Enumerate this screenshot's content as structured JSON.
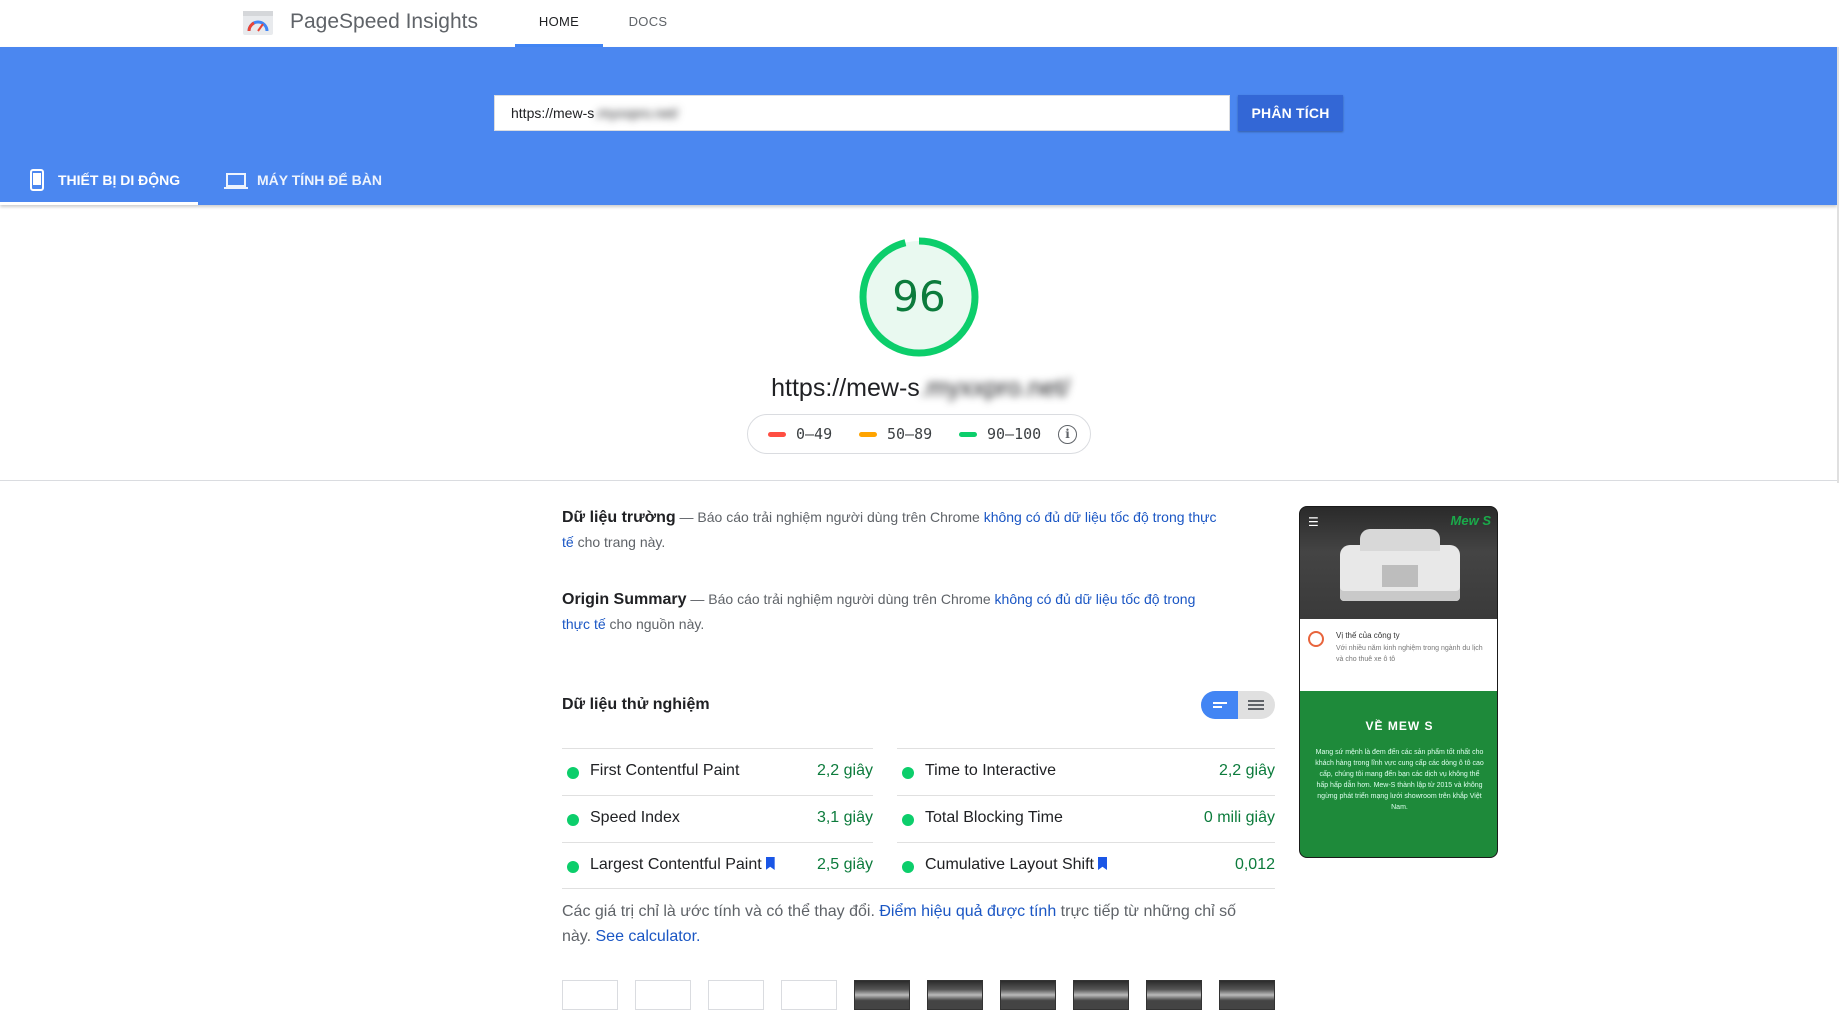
{
  "app": {
    "title": "PageSpeed Insights",
    "nav_tabs": [
      {
        "label": "HOME"
      },
      {
        "label": "DOCS"
      }
    ]
  },
  "search": {
    "url_value": "https://mew-s",
    "url_value_blurred": ".myxxpro.net/",
    "analyze_label": "PHÂN TÍCH"
  },
  "device_tabs": [
    {
      "label": "THIẾT BỊ DI ĐỘNG",
      "icon": "smartphone-icon",
      "selected": true
    },
    {
      "label": "MÁY TÍNH ĐỂ BÀN",
      "icon": "laptop-icon",
      "selected": false
    }
  ],
  "score": {
    "value": "96",
    "fraction": 0.96,
    "url": "https://mew-s",
    "url_blurred": ".myxxpro.net/",
    "color": "#0cce6b",
    "legend": [
      {
        "label": "0–49",
        "color": "#ff4e42"
      },
      {
        "label": "50–89",
        "color": "#ffa400"
      },
      {
        "label": "90–100",
        "color": "#0cce6b"
      }
    ],
    "legend_info_icon": "info-icon"
  },
  "field_data": {
    "title": "Dữ liệu trường",
    "text_before": " — Báo cáo trải nghiệm người dùng trên Chrome ",
    "link": "không có đủ dữ liệu tốc độ trong thực tế",
    "text_after": " cho trang này."
  },
  "origin_summary": {
    "title": "Origin Summary",
    "text_before": " — Báo cáo trải nghiệm người dùng trên Chrome ",
    "link": "không có đủ dữ liệu tốc độ trong thực tế",
    "text_after": " cho nguồn này."
  },
  "lab_data": {
    "title": "Dữ liệu thử nghiệm",
    "metrics_left": [
      {
        "name": "First Contentful Paint",
        "value": "2,2 giây",
        "flag": false
      },
      {
        "name": "Speed Index",
        "value": "3,1 giây",
        "flag": false
      },
      {
        "name": "Largest Contentful Paint",
        "value": "2,5 giây",
        "flag": true
      }
    ],
    "metrics_right": [
      {
        "name": "Time to Interactive",
        "value": "2,2 giây",
        "flag": false
      },
      {
        "name": "Total Blocking Time",
        "value": "0 mili giây",
        "flag": false
      },
      {
        "name": "Cumulative Layout Shift",
        "value": "0,012",
        "flag": true
      }
    ],
    "note_before": "Các giá trị chỉ là ước tính và có thể thay đổi. ",
    "note_link": "Điểm hiệu quả được tính",
    "note_middle": " trực tiếp từ những chỉ số này. ",
    "note_link2": "See calculator."
  },
  "preview": {
    "brand": "Mew S",
    "card_title": "Vị thế của công ty",
    "card_text": "Với nhiều năm kinh nghiệm trong ngành du lịch và cho thuê xe ô tô",
    "section_title": "VỀ MEW S",
    "section_text": "Mang sứ mệnh là đem đến các sản phẩm tốt nhất cho khách hàng trong lĩnh vực cung cấp các dòng ô tô cao cấp, chúng tôi mang đến bạn các dịch vụ không thể hấp hấp dẫn hơn. Mew-S thành lập từ 2015 và không ngừng phát triển mạng lưới showroom trên khắp Việt Nam."
  }
}
